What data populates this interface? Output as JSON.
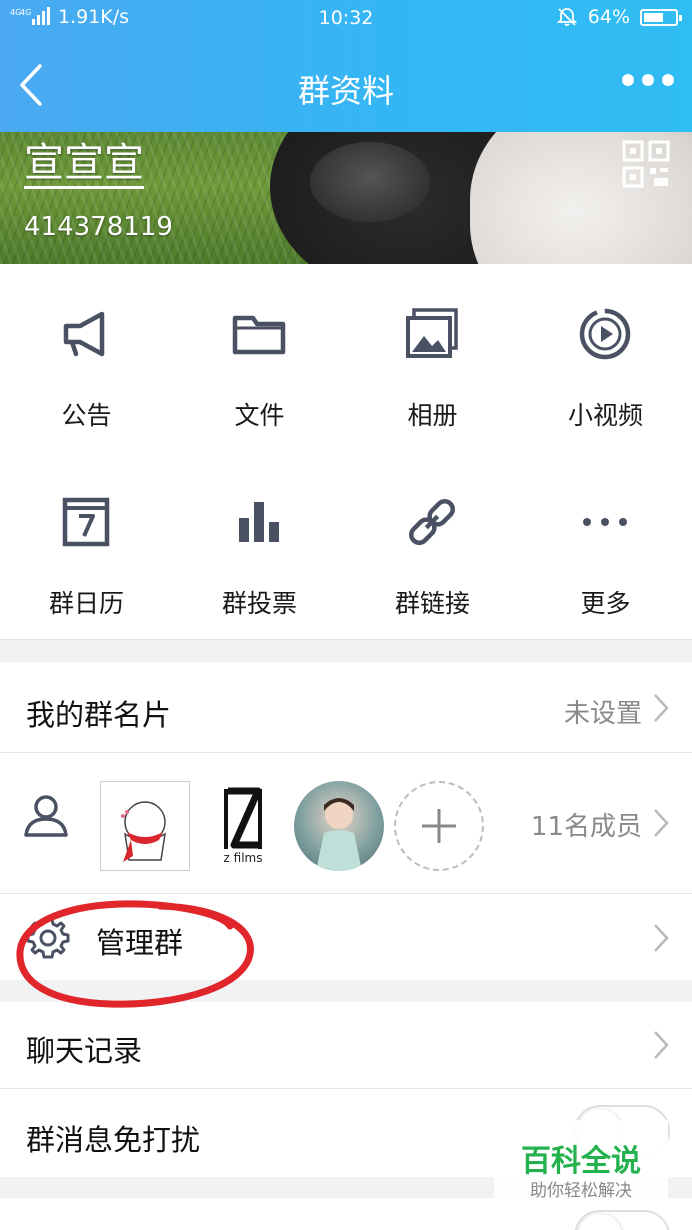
{
  "status_bar": {
    "network": "4G 4G",
    "speed": "1.91K/s",
    "time": "10:32",
    "battery": "64%",
    "battery_level": 0.64
  },
  "nav": {
    "title": "群资料",
    "back_icon": "chevron-left-icon",
    "more_icon": "more-dots-icon"
  },
  "group": {
    "name": "宣宣宣",
    "id": "414378119"
  },
  "features": [
    {
      "label": "公告",
      "icon": "megaphone-icon"
    },
    {
      "label": "文件",
      "icon": "folder-icon"
    },
    {
      "label": "相册",
      "icon": "album-icon"
    },
    {
      "label": "小视频",
      "icon": "video-icon"
    },
    {
      "label": "群日历",
      "icon": "calendar-icon"
    },
    {
      "label": "群投票",
      "icon": "bar-chart-icon"
    },
    {
      "label": "群链接",
      "icon": "link-icon"
    },
    {
      "label": "更多",
      "icon": "more-icon"
    }
  ],
  "rows": {
    "card_label": "我的群名片",
    "card_value": "未设置",
    "members_value": "11名成员",
    "avatar2_caption": "z films",
    "manage_label": "管理群",
    "history_label": "聊天记录",
    "dnd_label": "群消息免打扰"
  },
  "watermark": {
    "main": "百科全说",
    "sub": "助你轻松解决"
  },
  "colors": {
    "header_start": "#4aa9f2",
    "header_end": "#2fbdf3",
    "icon": "#4a5163",
    "annotation": "#e0262b",
    "watermark": "#24b24f"
  }
}
